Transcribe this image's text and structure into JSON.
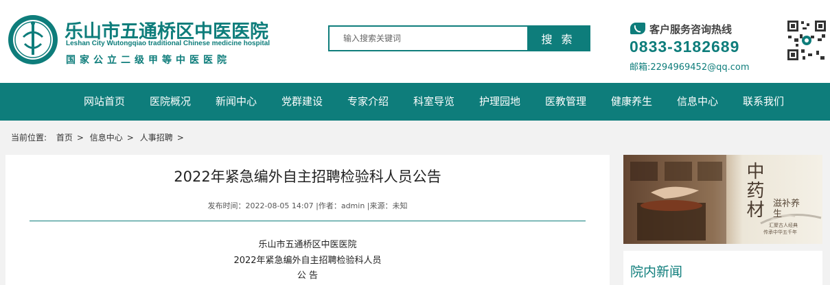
{
  "header": {
    "site_name_cn": "乐山市五通桥区中医医院",
    "site_name_en": "Leshan City Wutongqiao traditional Chinese medicine hospital",
    "site_subtitle": "国家公立二级甲等中医医院",
    "search": {
      "placeholder": "输入搜索关键词",
      "button_label": "搜 索"
    },
    "hotline": {
      "label": "客户服务咨询热线",
      "number": "0833-3182689",
      "email": "邮箱:2294969452@qq.com"
    }
  },
  "nav": {
    "items": [
      "网站首页",
      "医院概况",
      "新闻中心",
      "党群建设",
      "专家介绍",
      "科室导览",
      "护理园地",
      "医教管理",
      "健康养生",
      "信息中心",
      "联系我们"
    ]
  },
  "breadcrumb": {
    "label": "当前位置:",
    "items": [
      "首页",
      "信息中心",
      "人事招聘"
    ],
    "separator": ">"
  },
  "article": {
    "title": "2022年紧急编外自主招聘检验科人员公告",
    "meta": "发布时间：2022-08-05 14:07 |作者：admin |来源：未知",
    "body_lines": [
      "乐山市五通桥区中医医院",
      "2022年紧急编外自主招聘检验科人员",
      "公 告"
    ]
  },
  "sidebar": {
    "banner_text_main": "中药材",
    "banner_text_side": "滋补养生",
    "banner_caption_1": "汇聚古人经典",
    "banner_caption_2": "传承中华五千年",
    "news_title": "院内新闻"
  },
  "colors": {
    "brand": "#0e7d7b",
    "page_bg": "#f2f2f2"
  }
}
